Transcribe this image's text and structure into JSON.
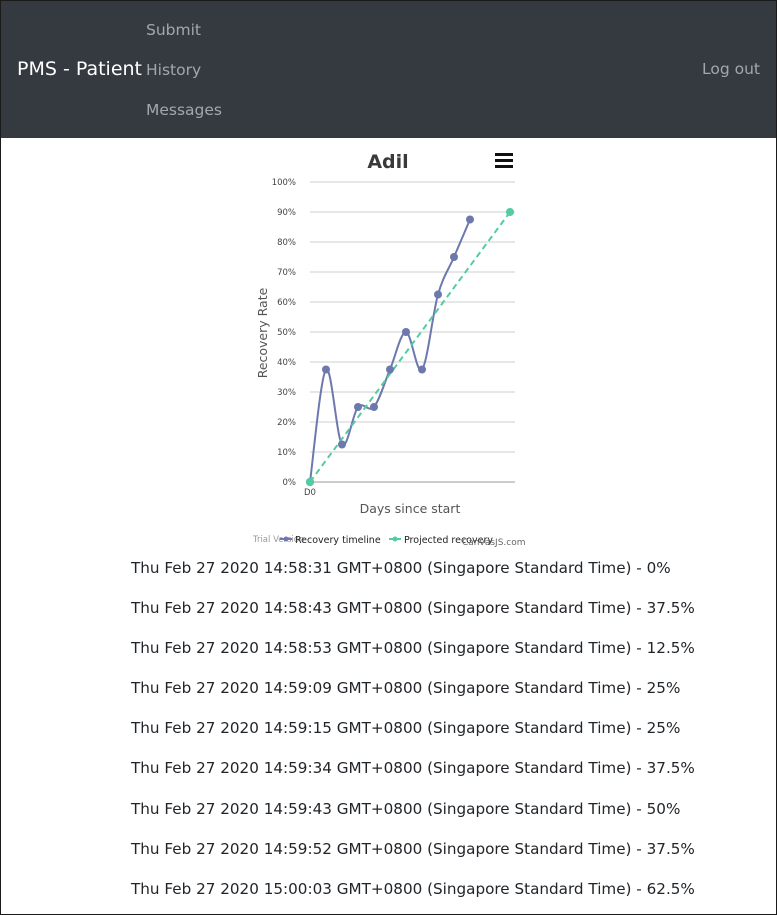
{
  "navbar": {
    "brand": "PMS - Patient",
    "items": [
      {
        "label": "Submit"
      },
      {
        "label": "History"
      },
      {
        "label": "Messages"
      }
    ],
    "logout": "Log out",
    "colors": {
      "background": "#343a40",
      "brand": "#ffffff",
      "link": "#9ea1a4"
    }
  },
  "chart_data": {
    "type": "line",
    "title": "Adil",
    "xlabel": "Days since start",
    "ylabel": "Recovery Rate",
    "x_tick_labels": [
      "D0"
    ],
    "y_ticks": [
      0,
      10,
      20,
      30,
      40,
      50,
      60,
      70,
      80,
      90,
      100
    ],
    "y_tick_suffix": "%",
    "ylim": [
      0,
      100
    ],
    "grid": true,
    "legend": "bottom",
    "menu_icon": "hamburger-icon",
    "watermark": "Trial Version",
    "credit": "CanvasJS.com",
    "series": [
      {
        "name": "Recovery timeline",
        "style": "spline",
        "color": "#6d78ad",
        "values": [
          0,
          37.5,
          12.5,
          25,
          25,
          37.5,
          50,
          37.5,
          62.5,
          75,
          87.5
        ]
      },
      {
        "name": "Projected recovery",
        "style": "dashed",
        "color": "#51cda0",
        "values": [
          0,
          90
        ]
      }
    ]
  },
  "history": [
    "Thu Feb 27 2020 14:58:31 GMT+0800 (Singapore Standard Time) - 0%",
    "Thu Feb 27 2020 14:58:43 GMT+0800 (Singapore Standard Time) - 37.5%",
    "Thu Feb 27 2020 14:58:53 GMT+0800 (Singapore Standard Time) - 12.5%",
    "Thu Feb 27 2020 14:59:09 GMT+0800 (Singapore Standard Time) - 25%",
    "Thu Feb 27 2020 14:59:15 GMT+0800 (Singapore Standard Time) - 25%",
    "Thu Feb 27 2020 14:59:34 GMT+0800 (Singapore Standard Time) - 37.5%",
    "Thu Feb 27 2020 14:59:43 GMT+0800 (Singapore Standard Time) - 50%",
    "Thu Feb 27 2020 14:59:52 GMT+0800 (Singapore Standard Time) - 37.5%",
    "Thu Feb 27 2020 15:00:03 GMT+0800 (Singapore Standard Time) - 62.5%"
  ]
}
